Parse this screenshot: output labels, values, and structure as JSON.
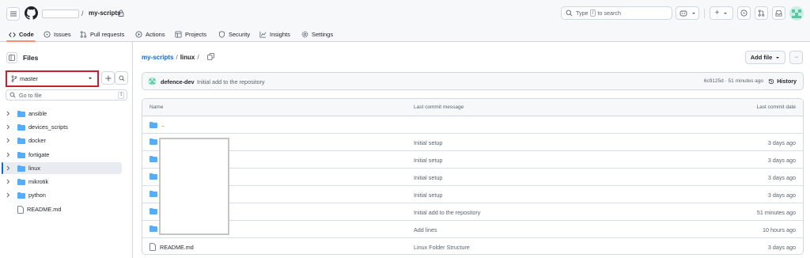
{
  "header": {
    "repo_name": "my-scripts",
    "path_separator": "/",
    "search_placeholder_pre": "Type",
    "search_key": "/",
    "search_placeholder_post": "to search",
    "plus_label": "+"
  },
  "tabs": [
    {
      "label": "Code",
      "icon": "code-icon",
      "active": true
    },
    {
      "label": "Issues",
      "icon": "issue-opened-icon"
    },
    {
      "label": "Pull requests",
      "icon": "git-pull-request-icon"
    },
    {
      "label": "Actions",
      "icon": "play-icon"
    },
    {
      "label": "Projects",
      "icon": "table-icon"
    },
    {
      "label": "Security",
      "icon": "shield-icon"
    },
    {
      "label": "Insights",
      "icon": "graph-icon"
    },
    {
      "label": "Settings",
      "icon": "gear-icon"
    }
  ],
  "sidebar": {
    "title": "Files",
    "branch": "master",
    "goto_placeholder": "Go to file",
    "goto_key": "t",
    "tree": [
      {
        "name": "ansible",
        "type": "folder"
      },
      {
        "name": "devices_scripts",
        "type": "folder"
      },
      {
        "name": "docker",
        "type": "folder"
      },
      {
        "name": "fortigate",
        "type": "folder"
      },
      {
        "name": "linux",
        "type": "folder",
        "selected": true
      },
      {
        "name": "mikrotik",
        "type": "folder"
      },
      {
        "name": "python",
        "type": "folder"
      },
      {
        "name": "README.md",
        "type": "file"
      }
    ]
  },
  "main": {
    "breadcrumb_repo": "my-scripts",
    "breadcrumb_dir": "linux",
    "breadcrumb_sep": "/",
    "add_file_label": "Add file",
    "more_label": "···",
    "commit": {
      "author": "defence-dev",
      "message": "Initial add to the repository",
      "meta": "6c9125d · 51 minutes ago",
      "history_label": "History"
    },
    "table": {
      "col_name": "Name",
      "col_message": "Last commit message",
      "col_date": "Last commit date",
      "rows": [
        {
          "name": "..",
          "type": "folder",
          "message": "",
          "date": ""
        },
        {
          "name": "",
          "type": "folder",
          "message": "Initial setup",
          "date": "3 days ago"
        },
        {
          "name": "",
          "type": "folder",
          "message": "Initial setup",
          "date": "3 days ago"
        },
        {
          "name": "",
          "type": "folder",
          "message": "Initial setup",
          "date": "3 days ago"
        },
        {
          "name": "",
          "type": "folder",
          "message": "Initial setup",
          "date": "3 days ago"
        },
        {
          "name": "",
          "type": "folder",
          "message": "Initial add to the repository",
          "date": "51 minutes ago"
        },
        {
          "name": "",
          "type": "folder",
          "message": "Add lines",
          "date": "10 hours ago"
        },
        {
          "name": "README.md",
          "type": "file",
          "message": "Linux Folder Structure",
          "date": "3 days ago"
        }
      ]
    }
  },
  "colors": {
    "accent": "#0969da",
    "folder": "#54aeff",
    "highlight_border": "#c8202d",
    "active_tab_underline": "#fd8c73"
  }
}
